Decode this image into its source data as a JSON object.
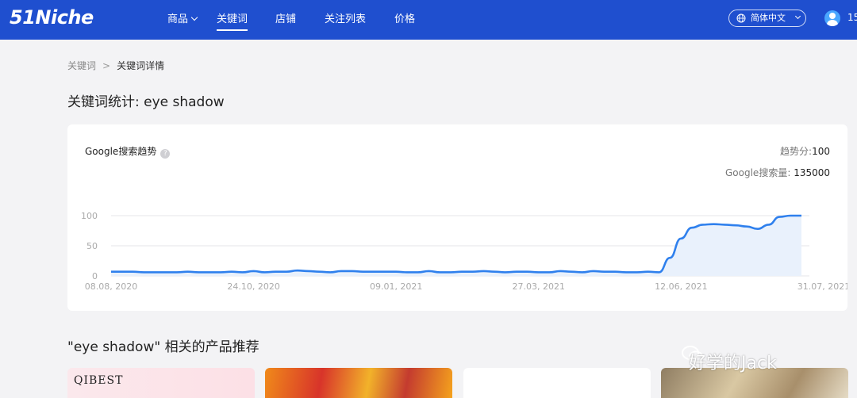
{
  "header": {
    "logo": "51Niche",
    "nav": [
      {
        "label": "商品"
      },
      {
        "label": "关键词"
      },
      {
        "label": "店铺"
      },
      {
        "label": "关注列表"
      },
      {
        "label": "价格"
      }
    ],
    "language": "简体中文",
    "user_text": "15"
  },
  "breadcrumb": {
    "parent": "关键词",
    "separator": ">",
    "current": "关键词详情"
  },
  "page_title": "关键词统计: eye shadow",
  "trend_card": {
    "title": "Google搜索趋势",
    "help_icon": "question-circle-icon",
    "score_label": "趋势分:",
    "score_value": "100",
    "volume_label": "Google搜索量: ",
    "volume_value": "135000"
  },
  "chart_data": {
    "type": "area",
    "y_ticks": [
      "100",
      "50",
      "0"
    ],
    "x_tick_labels": [
      "08.08, 2020",
      "24.10, 2020",
      "09.01, 2021",
      "27.03, 2021",
      "12.06, 2021",
      "31.07, 2021"
    ],
    "ylim": [
      0,
      100
    ],
    "grid": true,
    "line_color": "#2f80ed",
    "fill_color": "#e9f1fc",
    "series": [
      {
        "values": [
          7,
          7,
          7,
          6,
          6,
          6,
          6,
          7,
          6,
          6,
          6,
          7,
          6,
          8,
          6,
          7,
          7,
          9,
          8,
          7,
          6,
          8,
          8,
          7,
          7,
          7,
          7,
          6,
          6,
          8,
          6,
          6,
          7,
          7,
          8,
          7,
          6,
          7,
          7,
          6,
          6,
          8,
          7,
          6,
          8,
          7,
          7,
          6,
          6,
          7,
          6,
          30,
          62,
          80,
          85,
          86,
          85,
          84,
          82,
          78,
          85,
          98,
          100,
          100
        ]
      }
    ]
  },
  "related": {
    "title": "\"eye shadow\" 相关的产品推荐",
    "products": [
      {
        "brand": "QIBEST"
      }
    ]
  },
  "watermark": "好学的Jack"
}
